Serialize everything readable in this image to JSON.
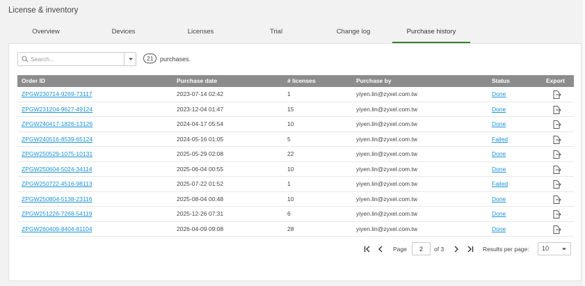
{
  "page": {
    "title": "License & inventory"
  },
  "tabs": [
    {
      "label": "Overview"
    },
    {
      "label": "Devices"
    },
    {
      "label": "Licenses"
    },
    {
      "label": "Trial"
    },
    {
      "label": "Change log"
    },
    {
      "label": "Purchase history"
    }
  ],
  "active_tab": "Purchase history",
  "search": {
    "placeholder": "Search...",
    "value": ""
  },
  "summary": {
    "count": "21",
    "label": "purchases."
  },
  "table": {
    "headers": {
      "order_id": "Order ID",
      "purchase_date": "Purchase date",
      "licenses": "# licenses",
      "purchase_by": "Purchase by",
      "status": "Status",
      "export": "Export"
    },
    "rows": [
      {
        "order_id": "ZPGW230714-9269-73117",
        "date": "2023-07-14 02:42",
        "licenses": "1",
        "by": "yiyen.lin@zyxel.com.tw",
        "status": "Done"
      },
      {
        "order_id": "ZPGW231204-9627-49124",
        "date": "2023-12-04 01:47",
        "licenses": "15",
        "by": "yiyen.lin@zyxel.com.tw",
        "status": "Done"
      },
      {
        "order_id": "ZPGW240417-1826-13126",
        "date": "2024-04-17 05:54",
        "licenses": "10",
        "by": "yiyen.lin@zyxel.com.tw",
        "status": "Done"
      },
      {
        "order_id": "ZPGW240516-8539-65124",
        "date": "2024-05-16 01:05",
        "licenses": "5",
        "by": "yiyen.lin@zyxel.com.tw",
        "status": "Failed"
      },
      {
        "order_id": "ZPGW250529-1075-10131",
        "date": "2025-05-29 02:08",
        "licenses": "22",
        "by": "yiyen.lin@zyxel.com.tw",
        "status": "Done"
      },
      {
        "order_id": "ZPGW250604-5024-34114",
        "date": "2025-06-04 00:55",
        "licenses": "10",
        "by": "yiyen.lin@zyxel.com.tw",
        "status": "Done"
      },
      {
        "order_id": "ZPGW250722-4516-98113",
        "date": "2025-07-22 01:52",
        "licenses": "1",
        "by": "yiyen.lin@zyxel.com.tw",
        "status": "Failed"
      },
      {
        "order_id": "ZPGW250804-5138-23116",
        "date": "2025-08-04 00:48",
        "licenses": "10",
        "by": "yiyen.lin@zyxel.com.tw",
        "status": "Done"
      },
      {
        "order_id": "ZPGW251226-7268-54119",
        "date": "2025-12-26 07:31",
        "licenses": "6",
        "by": "yiyen.lin@zyxel.com.tw",
        "status": "Done"
      },
      {
        "order_id": "ZPGW260409-8404-81104",
        "date": "2026-04-09 09:08",
        "licenses": "28",
        "by": "yiyen.lin@zyxel.com.tw",
        "status": "Done"
      }
    ]
  },
  "pager": {
    "page_label": "Page",
    "page_value": "2",
    "of_label": "of 3",
    "rpp_label": "Results per page:",
    "rpp_value": "10"
  },
  "colors": {
    "accent": "#3b7d2e",
    "link": "#1a93d5",
    "header_bg": "#8c8c8c"
  },
  "icons": [
    "search-icon",
    "chevron-down-icon",
    "export-icon",
    "first-page-icon",
    "prev-page-icon",
    "next-page-icon",
    "last-page-icon"
  ]
}
